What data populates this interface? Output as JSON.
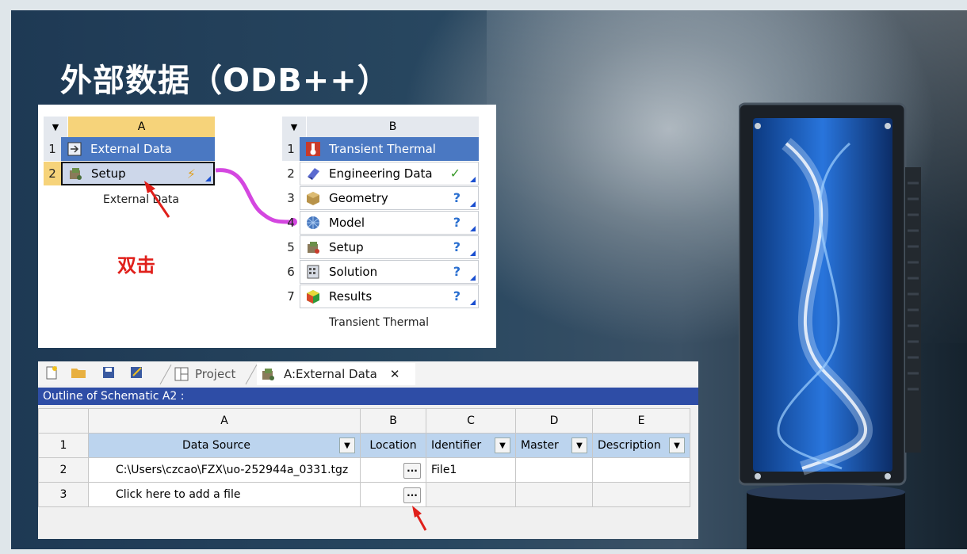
{
  "slide": {
    "title": "外部数据（ODB++）",
    "annotation": "双击"
  },
  "schematic": {
    "system_a": {
      "column_letter": "A",
      "rows": [
        {
          "num": "1",
          "label": "External Data",
          "icon": "external-data-icon"
        },
        {
          "num": "2",
          "label": "Setup",
          "icon": "setup-icon",
          "status": "⚡"
        }
      ],
      "caption": "External Data"
    },
    "system_b": {
      "column_letter": "B",
      "rows": [
        {
          "num": "1",
          "label": "Transient Thermal",
          "icon": "thermal-icon"
        },
        {
          "num": "2",
          "label": "Engineering Data",
          "icon": "engineering-data-icon",
          "status": "✓"
        },
        {
          "num": "3",
          "label": "Geometry",
          "icon": "geometry-icon",
          "status": "?"
        },
        {
          "num": "4",
          "label": "Model",
          "icon": "model-icon",
          "status": "?"
        },
        {
          "num": "5",
          "label": "Setup",
          "icon": "setup-icon",
          "status": "?"
        },
        {
          "num": "6",
          "label": "Solution",
          "icon": "solution-icon",
          "status": "?"
        },
        {
          "num": "7",
          "label": "Results",
          "icon": "results-icon",
          "status": "?"
        }
      ],
      "caption": "Transient Thermal"
    }
  },
  "outline": {
    "tabs": [
      {
        "label": "Project"
      },
      {
        "label": "A:External Data",
        "close": "✕"
      }
    ],
    "title": "Outline of Schematic A2 :",
    "column_letters": [
      "A",
      "B",
      "C",
      "D",
      "E"
    ],
    "header_row_num": "1",
    "headers": [
      "Data Source",
      "Location",
      "Identifier",
      "Master",
      "Description"
    ],
    "rows": [
      {
        "num": "2",
        "source": "C:\\Users\\czcao\\FZX\\uo-252944a_0331.tgz",
        "location_button": "...",
        "identifier": "File1",
        "master": "",
        "description": ""
      },
      {
        "num": "3",
        "source": "Click here to add a file",
        "location_button": "...",
        "identifier": "",
        "master": "",
        "description": ""
      }
    ]
  },
  "colors": {
    "accent_blue": "#4a78c2",
    "title_bar": "#2e4da6",
    "header_yellow": "#f6d37a",
    "arrow_red": "#e0201b",
    "link_magenta": "#d447e0"
  }
}
